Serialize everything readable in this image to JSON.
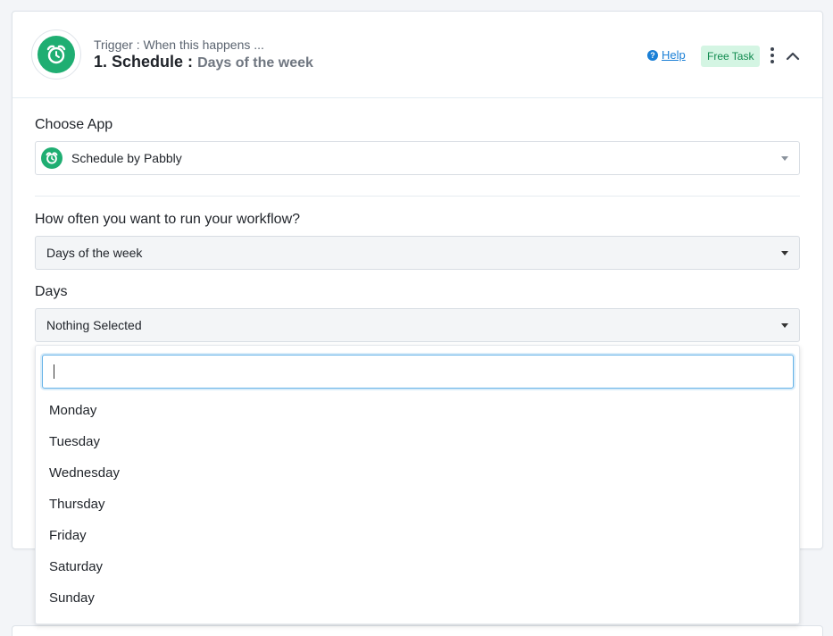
{
  "header": {
    "trigger_label": "Trigger : When this happens ...",
    "step_title": "1. Schedule :",
    "step_subtitle": "Days of the week",
    "help_label": "Help",
    "badge_label": "Free Task"
  },
  "choose_app": {
    "label": "Choose App",
    "selected": "Schedule by Pabbly"
  },
  "frequency": {
    "label": "How often you want to run your workflow?",
    "selected": "Days of the week"
  },
  "days": {
    "label": "Days",
    "selected": "Nothing Selected",
    "search_value": "",
    "options": [
      "Monday",
      "Tuesday",
      "Wednesday",
      "Thursday",
      "Friday",
      "Saturday",
      "Sunday"
    ]
  },
  "colors": {
    "brand_green": "#1fae72",
    "link_blue": "#1a7fd6",
    "badge_bg": "#d4f5e3",
    "badge_text": "#118a4f"
  },
  "icons": {
    "app": "alarm-clock-icon",
    "help": "question-circle-icon",
    "menu": "kebab-menu-icon",
    "collapse": "chevron-up-icon"
  }
}
